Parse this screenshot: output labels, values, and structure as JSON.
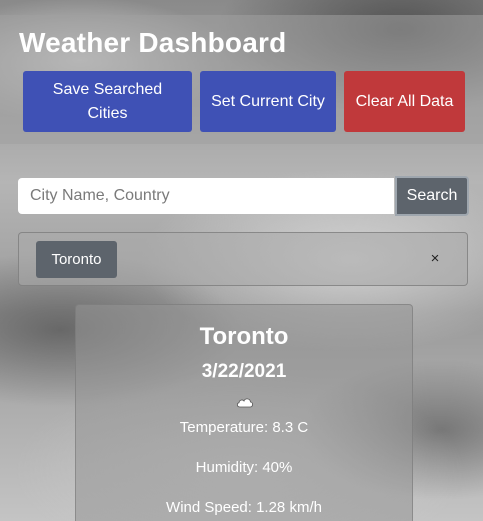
{
  "header": {
    "title": "Weather Dashboard",
    "buttons": {
      "save_label": "Save Searched Cities",
      "set_current_label": "Set Current City",
      "clear_label": "Clear All Data"
    }
  },
  "search": {
    "placeholder": "City Name, Country",
    "value": "",
    "button_label": "Search"
  },
  "history": {
    "items": [
      {
        "label": "Toronto"
      }
    ],
    "close_label": "×"
  },
  "weather": {
    "city": "Toronto",
    "date": "3/22/2021",
    "icon": "cloud-icon",
    "temperature": "Temperature: 8.3 C",
    "humidity": "Humidity: 40%",
    "wind_speed": "Wind Speed: 1.28 km/h"
  },
  "colors": {
    "primary_button": "#3f51b5",
    "danger_button": "#c0393b",
    "secondary_button": "#5d646c"
  }
}
